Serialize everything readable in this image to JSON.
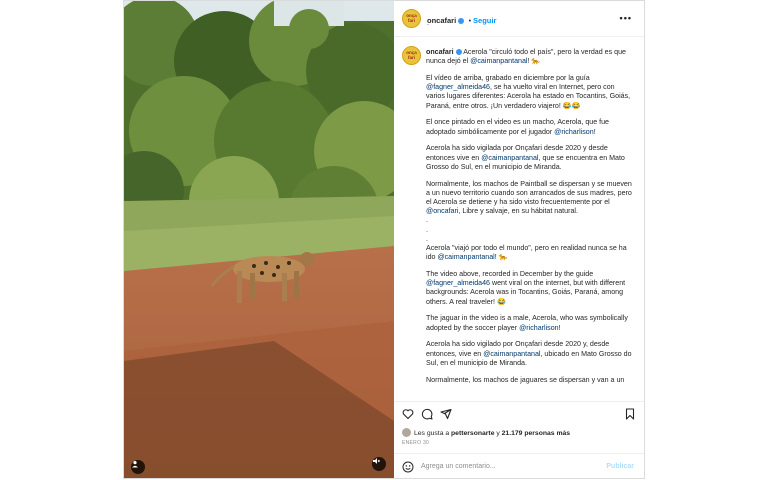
{
  "post": {
    "account": "oncafari",
    "follow_label": "Seguir",
    "subheading": ".",
    "avatar_text": "onça fari",
    "caption": {
      "username": "oncafari",
      "intro": "Acerola \"circuló todo el país\", pero la verdad es que nunca dejó el ",
      "intro_mention": "@caimanpantanal",
      "intro_tail": "! 🐆",
      "p2_a": "El vídeo de arriba, grabado en diciembre por la guía ",
      "p2_mention": "@fagner_almeida46",
      "p2_b": ", se ha vuelto viral en Internet, pero con varios lugares diferentes: Acerola ha estado en Tocantins, Goiás, Paraná, entre otros. ¡Un verdadero viajero! 😂😂",
      "p3_a": "El once pintado en el video es un macho, Acerola, que fue adoptado simbólicamente por el jugador ",
      "p3_mention": "@richarlison",
      "p3_b": "!",
      "p4_a": "Acerola ha sido vigilada por Onçafari desde 2020 y desde entonces vive en ",
      "p4_mention": "@caimanpantanal",
      "p4_b": ", que se encuentra en Mato Grosso do Sul, en el municipio de Miranda.",
      "p5_a": "Normalmente, los machos de Paintball se dispersan y se mueven a un nuevo territorio cuando son arrancados de sus madres, pero el Acerola se detiene y ha sido visto frecuentemente por el ",
      "p5_mention": "@oncafari",
      "p5_b": ", Libre y salvaje, en su hábitat natural.",
      "dots": [
        ".",
        ".",
        "."
      ],
      "p6_a": "Acerola \"viajó por todo el mundo\", pero en realidad nunca se ha ido ",
      "p6_mention": "@caimanpantanal",
      "p6_b": "! 🐆",
      "p7_a": "The video above, recorded in December by the guide ",
      "p7_mention": "@fagner_almeida46",
      "p7_b": " went viral on the internet, but with different backgrounds: Acerola was in Tocantins, Goiás, Paraná, among others. A real traveler! 😂",
      "p8_a": "The jaguar in the video is a male, Acerola, who was symbolically adopted by the soccer player ",
      "p8_mention": "@richarlison",
      "p8_b": "!",
      "p9_a": "Acerola ha sido vigilado por Onçafari desde 2020 y, desde entonces, vive en ",
      "p9_mention": "@caimanpantanal",
      "p9_b": ", ubicado en Mato Grosso do Sul, en el municipio de Miranda.",
      "p10": "Normalmente, los machos de jaguares se dispersan y van a un"
    },
    "likes": {
      "prefix": "Les gusta a ",
      "user": "pettersonarte",
      "middle": " y ",
      "count": "21.179 personas más"
    },
    "date": "ENERO 30",
    "comment_placeholder": "Agrega un comentario...",
    "publish_label": "Publicar"
  },
  "colors": {
    "link": "#00376b",
    "accent": "#0095f6",
    "border": "#dbdbdb"
  },
  "icons": [
    "heart-icon",
    "comment-icon",
    "share-icon",
    "bookmark-icon",
    "emoji-icon",
    "more-options-icon",
    "verified-icon",
    "user-tag-icon",
    "mute-icon"
  ]
}
